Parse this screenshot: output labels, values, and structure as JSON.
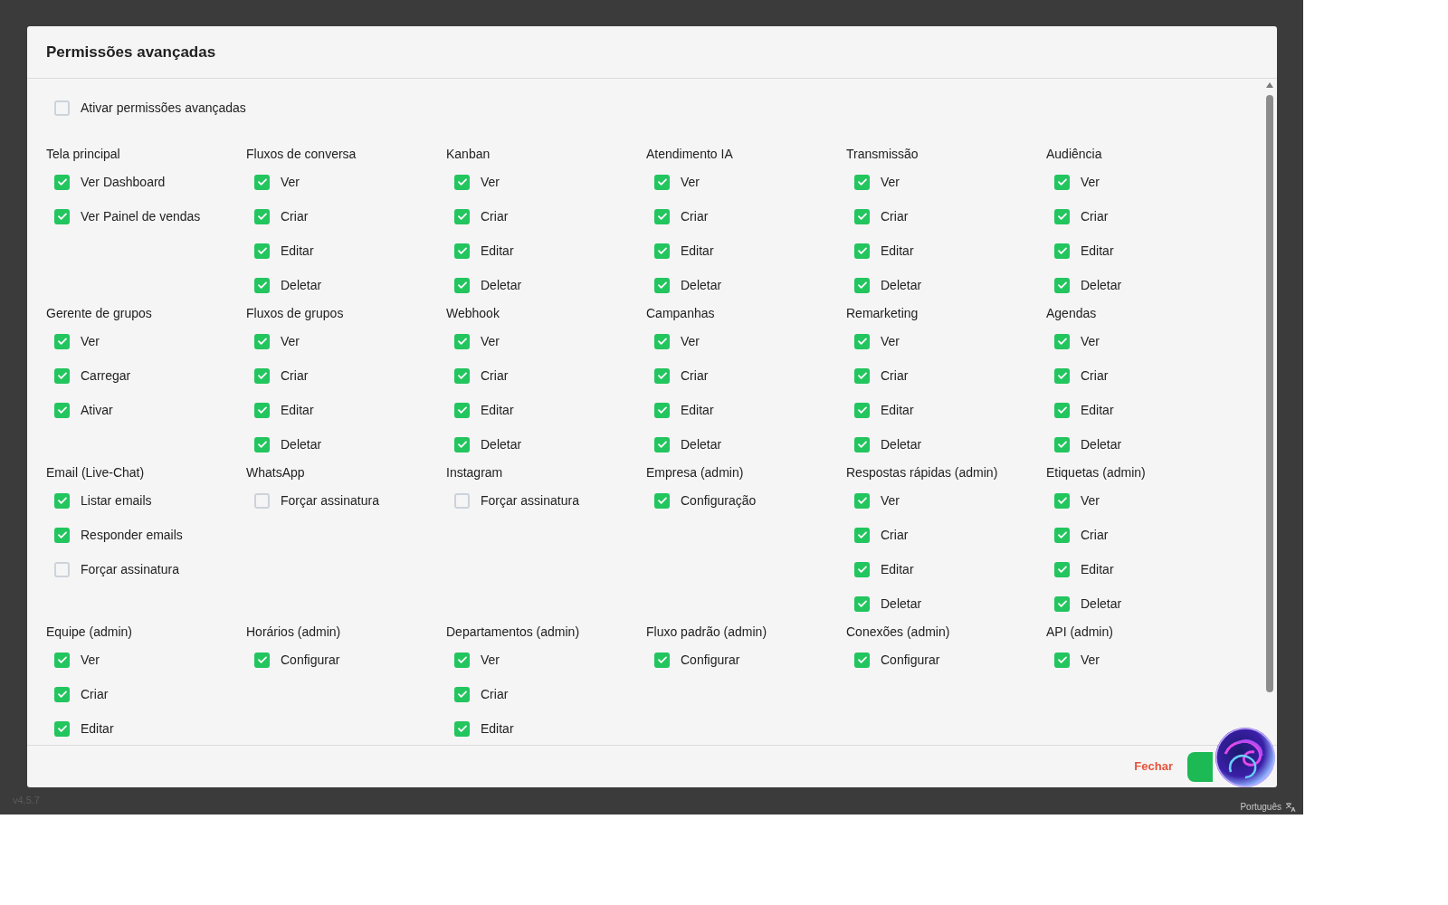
{
  "dialog": {
    "title": "Permissões avançadas"
  },
  "master_toggle": {
    "label": "Ativar permissões avançadas",
    "checked": false
  },
  "groups": [
    {
      "title": "Tela principal",
      "items": [
        {
          "label": "Ver Dashboard",
          "checked": true
        },
        {
          "label": "Ver Painel de vendas",
          "checked": true
        }
      ]
    },
    {
      "title": "Fluxos de conversa",
      "items": [
        {
          "label": "Ver",
          "checked": true
        },
        {
          "label": "Criar",
          "checked": true
        },
        {
          "label": "Editar",
          "checked": true
        },
        {
          "label": "Deletar",
          "checked": true
        }
      ]
    },
    {
      "title": "Kanban",
      "items": [
        {
          "label": "Ver",
          "checked": true
        },
        {
          "label": "Criar",
          "checked": true
        },
        {
          "label": "Editar",
          "checked": true
        },
        {
          "label": "Deletar",
          "checked": true
        }
      ]
    },
    {
      "title": "Atendimento IA",
      "items": [
        {
          "label": "Ver",
          "checked": true
        },
        {
          "label": "Criar",
          "checked": true
        },
        {
          "label": "Editar",
          "checked": true
        },
        {
          "label": "Deletar",
          "checked": true
        }
      ]
    },
    {
      "title": "Transmissão",
      "items": [
        {
          "label": "Ver",
          "checked": true
        },
        {
          "label": "Criar",
          "checked": true
        },
        {
          "label": "Editar",
          "checked": true
        },
        {
          "label": "Deletar",
          "checked": true
        }
      ]
    },
    {
      "title": "Audiência",
      "items": [
        {
          "label": "Ver",
          "checked": true
        },
        {
          "label": "Criar",
          "checked": true
        },
        {
          "label": "Editar",
          "checked": true
        },
        {
          "label": "Deletar",
          "checked": true
        }
      ]
    },
    {
      "title": "Gerente de grupos",
      "items": [
        {
          "label": "Ver",
          "checked": true
        },
        {
          "label": "Carregar",
          "checked": true
        },
        {
          "label": "Ativar",
          "checked": true
        }
      ]
    },
    {
      "title": "Fluxos de grupos",
      "items": [
        {
          "label": "Ver",
          "checked": true
        },
        {
          "label": "Criar",
          "checked": true
        },
        {
          "label": "Editar",
          "checked": true
        },
        {
          "label": "Deletar",
          "checked": true
        }
      ]
    },
    {
      "title": "Webhook",
      "items": [
        {
          "label": "Ver",
          "checked": true
        },
        {
          "label": "Criar",
          "checked": true
        },
        {
          "label": "Editar",
          "checked": true
        },
        {
          "label": "Deletar",
          "checked": true
        }
      ]
    },
    {
      "title": "Campanhas",
      "items": [
        {
          "label": "Ver",
          "checked": true
        },
        {
          "label": "Criar",
          "checked": true
        },
        {
          "label": "Editar",
          "checked": true
        },
        {
          "label": "Deletar",
          "checked": true
        }
      ]
    },
    {
      "title": "Remarketing",
      "items": [
        {
          "label": "Ver",
          "checked": true
        },
        {
          "label": "Criar",
          "checked": true
        },
        {
          "label": "Editar",
          "checked": true
        },
        {
          "label": "Deletar",
          "checked": true
        }
      ]
    },
    {
      "title": "Agendas",
      "items": [
        {
          "label": "Ver",
          "checked": true
        },
        {
          "label": "Criar",
          "checked": true
        },
        {
          "label": "Editar",
          "checked": true
        },
        {
          "label": "Deletar",
          "checked": true
        }
      ]
    },
    {
      "title": "Email (Live-Chat)",
      "items": [
        {
          "label": "Listar emails",
          "checked": true
        },
        {
          "label": "Responder emails",
          "checked": true
        },
        {
          "label": "Forçar assinatura",
          "checked": false
        }
      ]
    },
    {
      "title": "WhatsApp",
      "items": [
        {
          "label": "Forçar assinatura",
          "checked": false
        }
      ]
    },
    {
      "title": "Instagram",
      "items": [
        {
          "label": "Forçar assinatura",
          "checked": false
        }
      ]
    },
    {
      "title": "Empresa (admin)",
      "items": [
        {
          "label": "Configuração",
          "checked": true
        }
      ]
    },
    {
      "title": "Respostas rápidas (admin)",
      "items": [
        {
          "label": "Ver",
          "checked": true
        },
        {
          "label": "Criar",
          "checked": true
        },
        {
          "label": "Editar",
          "checked": true
        },
        {
          "label": "Deletar",
          "checked": true
        }
      ]
    },
    {
      "title": "Etiquetas (admin)",
      "items": [
        {
          "label": "Ver",
          "checked": true
        },
        {
          "label": "Criar",
          "checked": true
        },
        {
          "label": "Editar",
          "checked": true
        },
        {
          "label": "Deletar",
          "checked": true
        }
      ]
    },
    {
      "title": "Equipe (admin)",
      "items": [
        {
          "label": "Ver",
          "checked": true
        },
        {
          "label": "Criar",
          "checked": true
        },
        {
          "label": "Editar",
          "checked": true
        }
      ]
    },
    {
      "title": "Horários (admin)",
      "items": [
        {
          "label": "Configurar",
          "checked": true
        }
      ]
    },
    {
      "title": "Departamentos (admin)",
      "items": [
        {
          "label": "Ver",
          "checked": true
        },
        {
          "label": "Criar",
          "checked": true
        },
        {
          "label": "Editar",
          "checked": true
        }
      ]
    },
    {
      "title": "Fluxo padrão (admin)",
      "items": [
        {
          "label": "Configurar",
          "checked": true
        }
      ]
    },
    {
      "title": "Conexões (admin)",
      "items": [
        {
          "label": "Configurar",
          "checked": true
        }
      ]
    },
    {
      "title": "API (admin)",
      "items": [
        {
          "label": "Ver",
          "checked": true
        }
      ]
    }
  ],
  "footer": {
    "close_label": "Fechar"
  },
  "background": {
    "version": "v4.5.7",
    "language": "Português"
  }
}
